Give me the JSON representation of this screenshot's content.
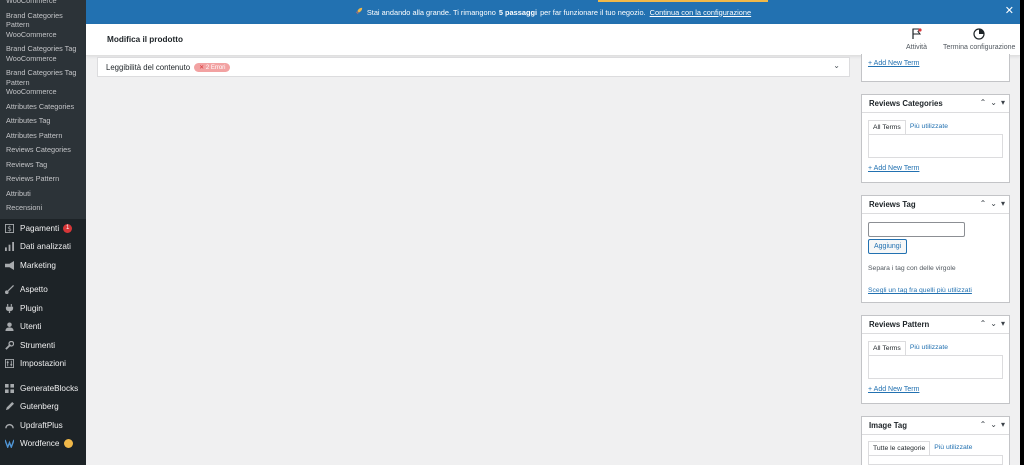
{
  "sidebar": {
    "sub_items": [
      "WooCommerce",
      "Brand Categories Pattern WooCommerce",
      "Brand Categories Tag WooCommerce",
      "Brand Categories Tag Pattern WooCommerce",
      "Attributes Categories",
      "Attributes Tag",
      "Attributes Pattern",
      "Reviews Categories",
      "Reviews Tag",
      "Reviews Pattern",
      "Attributi",
      "Recensioni"
    ],
    "menu": {
      "pagamenti": "Pagamenti",
      "pagamenti_badge": "1",
      "dati": "Dati analizzati",
      "marketing": "Marketing",
      "aspetto": "Aspetto",
      "plugin": "Plugin",
      "utenti": "Utenti",
      "strumenti": "Strumenti",
      "impostazioni": "Impostazioni",
      "generateblocks": "GenerateBlocks",
      "gutenberg": "Gutenberg",
      "updraftplus": "UpdraftPlus",
      "wordfence": "Wordfence"
    }
  },
  "notice": {
    "prefix": "Stai andando alla grande. Ti rimangono",
    "bold": "5 passaggi",
    "suffix": "per far funzionare il tuo negozio.",
    "link": "Continua con la configurazione"
  },
  "header": {
    "title": "Modifica il prodotto",
    "activity": "Attività",
    "finish": "Termina configurazione"
  },
  "seo_panel": {
    "label": "Leggibilità del contenuto",
    "errors": "2 Errori"
  },
  "boxes": {
    "first_add_term": "+ Add New Term",
    "reviews_categories": {
      "title": "Reviews Categories",
      "tab_all": "All Terms",
      "tab_popular": "Più utilizzate",
      "add_term": "+ Add New Term"
    },
    "reviews_tag": {
      "title": "Reviews Tag",
      "add_button": "Aggiungi",
      "hint": "Separa i tag con delle virgole",
      "choose": "Scegli un tag fra quelli più utilizzati"
    },
    "reviews_pattern": {
      "title": "Reviews Pattern",
      "tab_all": "All Terms",
      "tab_popular": "Più utilizzate",
      "add_term": "+ Add New Term"
    },
    "image_tag": {
      "title": "Image Tag",
      "tab_all": "Tutte le categorie",
      "tab_popular": "Più utilizzate"
    }
  },
  "colors": {
    "sidebar": "#1d2327",
    "notice": "#2271b1",
    "accent": "#f0b849",
    "link": "#2271b1"
  },
  "icons": {
    "notice": "rocket-icon",
    "close": "close-icon",
    "activity": "flag-icon",
    "finish": "progress-circle-icon"
  }
}
